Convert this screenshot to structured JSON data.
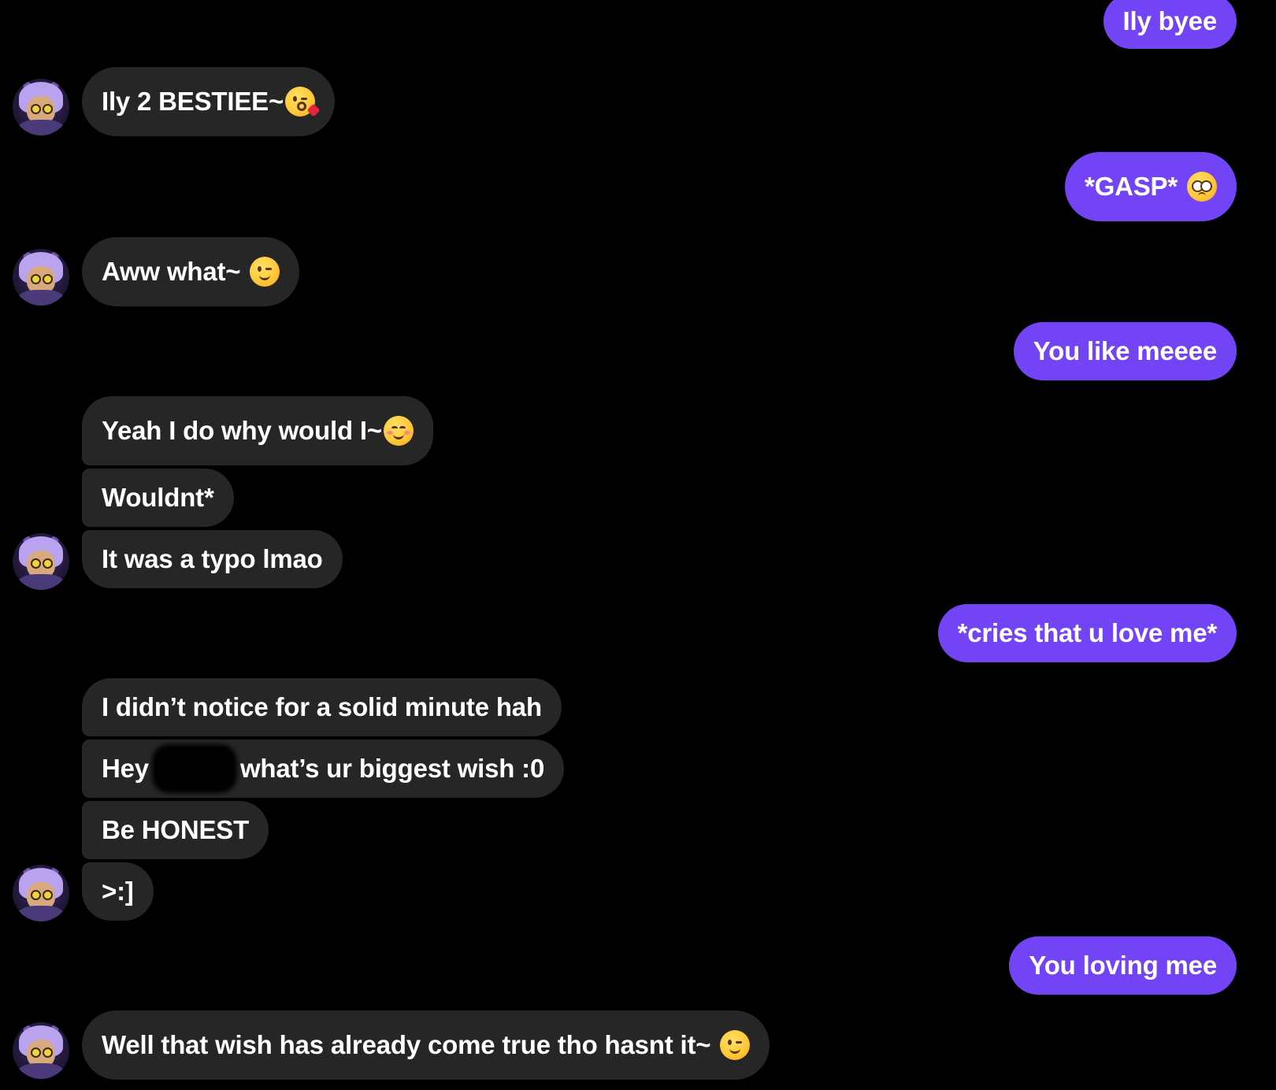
{
  "conversation": {
    "messages": [
      {
        "sender": "me",
        "text": "Ily byee"
      },
      {
        "sender": "them",
        "text": "Ily 2 BESTIEE~",
        "emoji": "kissing-face-icon"
      },
      {
        "sender": "me",
        "text": "*GASP*",
        "emoji": "pleading-face-icon"
      },
      {
        "sender": "them",
        "text": "Aww what~",
        "emoji": "winking-face-icon"
      },
      {
        "sender": "me",
        "text": "You like meeee"
      },
      {
        "sender": "them",
        "text": "Yeah I do why would I~",
        "emoji": "smiling-blush-face-icon"
      },
      {
        "sender": "them",
        "text": "Wouldnt*"
      },
      {
        "sender": "them",
        "text": "It was a typo lmao"
      },
      {
        "sender": "me",
        "text": "*cries that u love me*"
      },
      {
        "sender": "them",
        "text": "I didn’t notice for a solid minute hah"
      },
      {
        "sender": "them",
        "text_before": "Hey",
        "text_after": "what’s ur biggest wish :0",
        "redacted": true
      },
      {
        "sender": "them",
        "text": "Be HONEST"
      },
      {
        "sender": "them",
        "text": ">:]"
      },
      {
        "sender": "me",
        "text": "You loving mee"
      },
      {
        "sender": "them",
        "text": "Well that wish has already come true tho hasnt it~",
        "emoji": "winking-face-icon"
      }
    ]
  },
  "colors": {
    "background": "#000000",
    "outgoing_bubble": "#7344f6",
    "incoming_bubble": "#262626",
    "text": "#ffffff"
  }
}
